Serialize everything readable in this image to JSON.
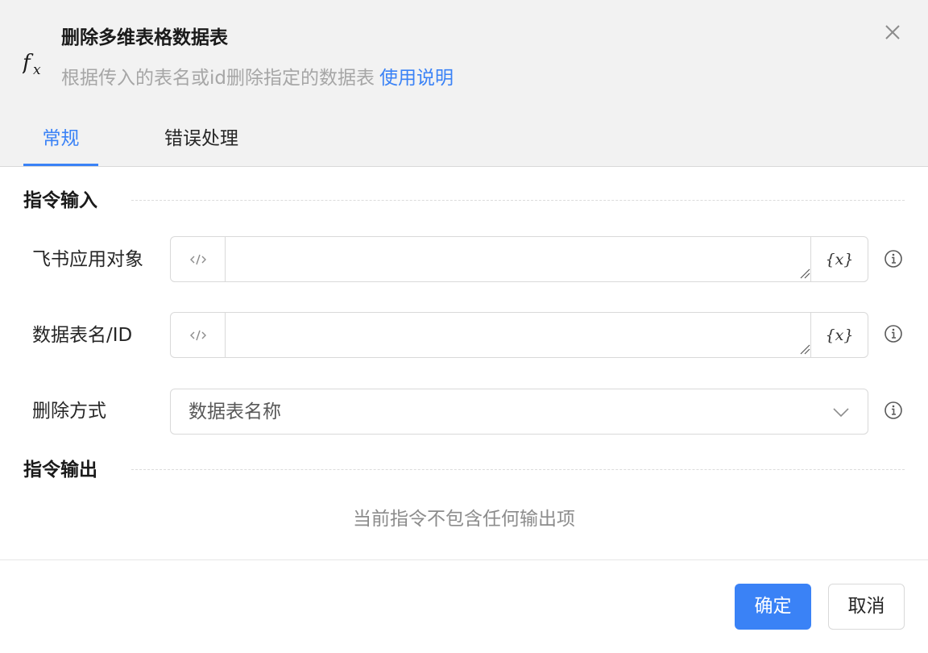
{
  "dialog": {
    "title": "删除多维表格数据表",
    "description": "根据传入的表名或id删除指定的数据表",
    "help_link": "使用说明",
    "icon": "fx-icon",
    "close_icon": "close-icon"
  },
  "tabs": [
    {
      "label": "常规",
      "active": true
    },
    {
      "label": "错误处理",
      "active": false
    }
  ],
  "input_section": {
    "title": "指令输入",
    "fields": [
      {
        "label": "飞书应用对象",
        "value": "",
        "prefix_icon": "code-icon",
        "suffix_label": "{x}"
      },
      {
        "label": "数据表名/ID",
        "value": "",
        "prefix_icon": "code-icon",
        "suffix_label": "{x}"
      },
      {
        "label": "删除方式",
        "selected": "数据表名称",
        "suffix_icon": "chevron-down-icon"
      }
    ]
  },
  "output_section": {
    "title": "指令输出",
    "empty_text": "当前指令不包含任何输出项"
  },
  "footer": {
    "confirm_label": "确定",
    "cancel_label": "取消"
  },
  "colors": {
    "accent": "#3a82f6",
    "header_bg": "#f2f2f2"
  }
}
